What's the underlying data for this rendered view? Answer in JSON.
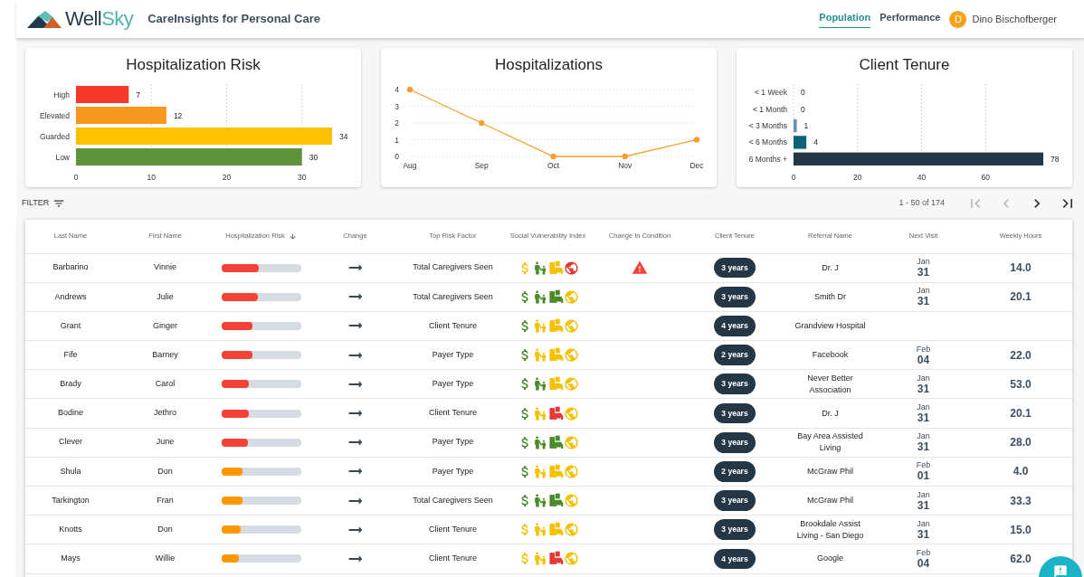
{
  "header": {
    "logo": {
      "first": "Well",
      "second": "Sky"
    },
    "app_title": "CareInsights for Personal Care",
    "nav": [
      {
        "label": "Population",
        "selected": true
      },
      {
        "label": "Performance",
        "selected": false
      }
    ],
    "user": {
      "initial": "D",
      "name": "Dino Bischofberger"
    }
  },
  "charts": [
    {
      "chart_data": {
        "type": "bar",
        "orientation": "horizontal",
        "title": "Hospitalization Risk",
        "categories": [
          "High",
          "Elevated",
          "Guarded",
          "Low"
        ],
        "series": [
          {
            "values": [
              7,
              12,
              34,
              30
            ]
          }
        ],
        "colors": [
          "#f4392b",
          "#f7971f",
          "#fcc200",
          "#5f933b"
        ],
        "xlim": [
          0,
          34
        ],
        "xticks": [
          0,
          10,
          20,
          30
        ],
        "grid": true,
        "data_labels": true
      }
    },
    {
      "chart_data": {
        "type": "line",
        "title": "Hospitalizations",
        "x": [
          "Aug",
          "Sep",
          "Oct",
          "Nov",
          "Dec"
        ],
        "series": [
          {
            "color": "#f7a030",
            "marker": true,
            "values": [
              4,
              2,
              0,
              0,
              1
            ]
          }
        ],
        "ylim": [
          0,
          4
        ],
        "yticks": [
          0,
          1,
          2,
          3,
          4
        ],
        "grid": true
      }
    },
    {
      "chart_data": {
        "type": "bar",
        "orientation": "horizontal",
        "title": "Client Tenure",
        "categories": [
          "< 1 Week",
          "< 1 Month",
          "< 3 Months",
          "< 6 Months",
          "6 Months +"
        ],
        "series": [
          {
            "values": [
              0,
              0,
              1,
              4,
              78
            ]
          }
        ],
        "colors": [
          "#6a8fb0",
          "#6a8fb0",
          "#6a8fb0",
          "#0e6474",
          "#243746"
        ],
        "xlim": [
          0,
          78
        ],
        "xticks": [
          0,
          20,
          40,
          60
        ],
        "grid": true,
        "data_labels": true
      }
    }
  ],
  "filter": {
    "label": "FILTER"
  },
  "pagination": {
    "range": "1 - 50 of 174",
    "first_disabled": true,
    "prev_disabled": true,
    "next_disabled": false,
    "last_disabled": false
  },
  "table": {
    "columns": [
      {
        "label": "Last Name"
      },
      {
        "label": "First Name"
      },
      {
        "label": "Hospitalization Risk",
        "sorted": true
      },
      {
        "label": "Change"
      },
      {
        "label": "Top Risk Factor"
      },
      {
        "label": "Social Vulnerability Index"
      },
      {
        "label": "Change In Condition"
      },
      {
        "label": "Client Tenure"
      },
      {
        "label": "Referral Name"
      },
      {
        "label": "Next Visit"
      },
      {
        "label": "Weekly Hours"
      }
    ],
    "rows": [
      {
        "last": "Barbarino",
        "first": "Vinnie",
        "risk": {
          "level": 0.47,
          "color": "#f44336"
        },
        "factor": "Total Caregivers Seen",
        "svi": [
          {
            "kind": "money",
            "color": "#f5c000"
          },
          {
            "kind": "family",
            "color": "#4a8a2a"
          },
          {
            "kind": "transport",
            "color": "#f5c000"
          },
          {
            "kind": "globe",
            "color": "#e53935"
          }
        ],
        "condition_alert": true,
        "tenure": "3 years",
        "referral": "Dr. J",
        "visit_month": "Jan",
        "visit_day": "31",
        "hours": "14.0"
      },
      {
        "last": "Andrews",
        "first": "Julie",
        "risk": {
          "level": 0.46,
          "color": "#f44336"
        },
        "factor": "Total Caregivers Seen",
        "svi": [
          {
            "kind": "money",
            "color": "#4a8a2a"
          },
          {
            "kind": "family",
            "color": "#4a8a2a"
          },
          {
            "kind": "transport",
            "color": "#4a8a2a"
          },
          {
            "kind": "globe",
            "color": "#f5c000"
          }
        ],
        "condition_alert": false,
        "tenure": "3 years",
        "referral": "Smith Dr",
        "visit_month": "Jan",
        "visit_day": "31",
        "hours": "20.1"
      },
      {
        "last": "Grant",
        "first": "Ginger",
        "risk": {
          "level": 0.39,
          "color": "#f44336"
        },
        "factor": "Client Tenure",
        "svi": [
          {
            "kind": "money",
            "color": "#4a8a2a"
          },
          {
            "kind": "family",
            "color": "#f5c000"
          },
          {
            "kind": "transport",
            "color": "#f5c000"
          },
          {
            "kind": "globe",
            "color": "#f5c000"
          }
        ],
        "condition_alert": false,
        "tenure": "4 years",
        "referral": "Grandview Hospital"
      },
      {
        "last": "Fife",
        "first": "Barney",
        "risk": {
          "level": 0.39,
          "color": "#f44336"
        },
        "factor": "Payer Type",
        "svi": [
          {
            "kind": "money",
            "color": "#4a8a2a"
          },
          {
            "kind": "family",
            "color": "#f5c000"
          },
          {
            "kind": "transport",
            "color": "#f5c000"
          },
          {
            "kind": "globe",
            "color": "#f5c000"
          }
        ],
        "condition_alert": false,
        "tenure": "2 years",
        "referral": "Facebook",
        "visit_month": "Feb",
        "visit_day": "04",
        "hours": "22.0"
      },
      {
        "last": "Brady",
        "first": "Carol",
        "risk": {
          "level": 0.35,
          "color": "#f44336"
        },
        "factor": "Payer Type",
        "svi": [
          {
            "kind": "money",
            "color": "#4a8a2a"
          },
          {
            "kind": "family",
            "color": "#4a8a2a"
          },
          {
            "kind": "transport",
            "color": "#f5c000"
          },
          {
            "kind": "globe",
            "color": "#f5c000"
          }
        ],
        "condition_alert": false,
        "tenure": "3 years",
        "referral": "Never Better Association",
        "visit_month": "Jan",
        "visit_day": "31",
        "hours": "53.0"
      },
      {
        "last": "Bodine",
        "first": "Jethro",
        "risk": {
          "level": 0.35,
          "color": "#f44336"
        },
        "factor": "Client Tenure",
        "svi": [
          {
            "kind": "money",
            "color": "#4a8a2a"
          },
          {
            "kind": "family",
            "color": "#f5c000"
          },
          {
            "kind": "transport",
            "color": "#e53935"
          },
          {
            "kind": "globe",
            "color": "#f5c000"
          }
        ],
        "condition_alert": false,
        "tenure": "3 years",
        "referral": "Dr. J",
        "visit_month": "Jan",
        "visit_day": "31",
        "hours": "20.1"
      },
      {
        "last": "Clever",
        "first": "June",
        "risk": {
          "level": 0.34,
          "color": "#f44336"
        },
        "factor": "Payer Type",
        "svi": [
          {
            "kind": "money",
            "color": "#4a8a2a"
          },
          {
            "kind": "family",
            "color": "#4a8a2a"
          },
          {
            "kind": "transport",
            "color": "#4a8a2a"
          },
          {
            "kind": "globe",
            "color": "#f5c000"
          }
        ],
        "condition_alert": false,
        "tenure": "3 years",
        "referral": "Bay Area Assisted Living",
        "visit_month": "Jan",
        "visit_day": "31",
        "hours": "28.0"
      },
      {
        "last": "Shula",
        "first": "Don",
        "risk": {
          "level": 0.27,
          "color": "#ff9800"
        },
        "factor": "Payer Type",
        "svi": [
          {
            "kind": "money",
            "color": "#4a8a2a"
          },
          {
            "kind": "family",
            "color": "#f5c000"
          },
          {
            "kind": "transport",
            "color": "#f5c000"
          },
          {
            "kind": "globe",
            "color": "#f5c000"
          }
        ],
        "condition_alert": false,
        "tenure": "2 years",
        "referral": "McGraw Phil",
        "visit_month": "Feb",
        "visit_day": "01",
        "hours": "4.0"
      },
      {
        "last": "Tarkington",
        "first": "Fran",
        "risk": {
          "level": 0.27,
          "color": "#ff9800"
        },
        "factor": "Total Caregivers Seen",
        "svi": [
          {
            "kind": "money",
            "color": "#4a8a2a"
          },
          {
            "kind": "family",
            "color": "#4a8a2a"
          },
          {
            "kind": "transport",
            "color": "#4a8a2a"
          },
          {
            "kind": "globe",
            "color": "#f5c000"
          }
        ],
        "condition_alert": false,
        "tenure": "3 years",
        "referral": "McGraw Phil",
        "visit_month": "Jan",
        "visit_day": "31",
        "hours": "33.3"
      },
      {
        "last": "Knotts",
        "first": "Don",
        "risk": {
          "level": 0.24,
          "color": "#ff9800"
        },
        "factor": "Client Tenure",
        "svi": [
          {
            "kind": "money",
            "color": "#f5c000"
          },
          {
            "kind": "family",
            "color": "#f5c000"
          },
          {
            "kind": "transport",
            "color": "#f5c000"
          },
          {
            "kind": "globe",
            "color": "#f5c000"
          }
        ],
        "condition_alert": false,
        "tenure": "3 years",
        "referral": "Brookdale Assist Living - San Diego",
        "visit_month": "Jan",
        "visit_day": "31",
        "hours": "15.0"
      },
      {
        "last": "Mays",
        "first": "Willie",
        "risk": {
          "level": 0.22,
          "color": "#ff9800"
        },
        "factor": "Client Tenure",
        "svi": [
          {
            "kind": "money",
            "color": "#f5c000"
          },
          {
            "kind": "family",
            "color": "#f5c000"
          },
          {
            "kind": "transport",
            "color": "#e53935"
          },
          {
            "kind": "globe",
            "color": "#f5c000"
          }
        ],
        "condition_alert": false,
        "tenure": "4 years",
        "referral": "Google",
        "visit_month": "Feb",
        "visit_day": "04",
        "hours": "62.0"
      }
    ]
  }
}
